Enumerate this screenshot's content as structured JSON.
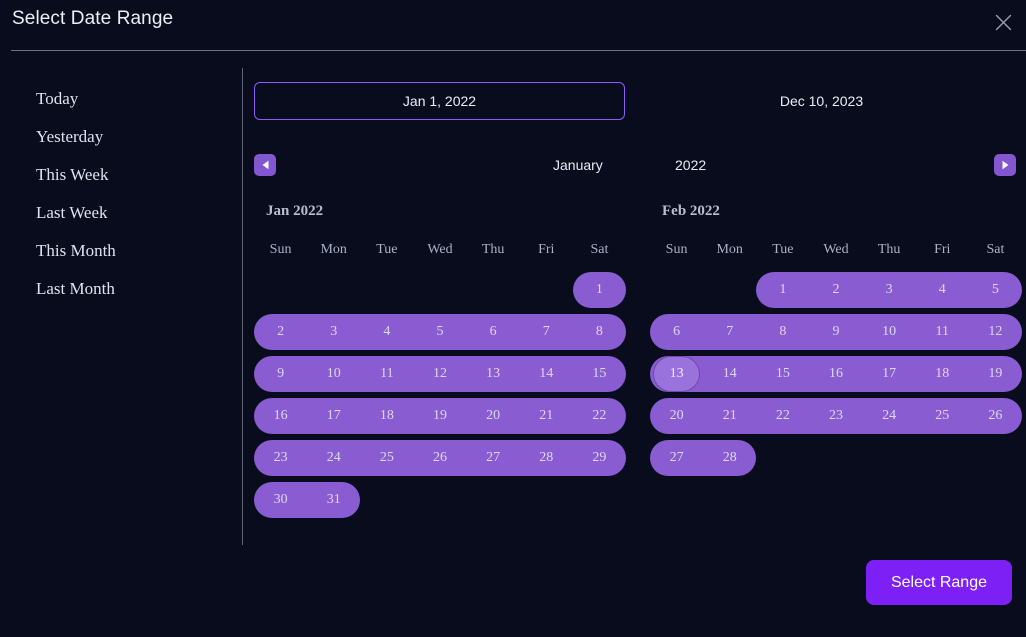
{
  "dialog": {
    "title": "Select Date Range",
    "close_icon": "close-icon"
  },
  "sidebar": {
    "presets": [
      {
        "label": "Today"
      },
      {
        "label": "Yesterday"
      },
      {
        "label": "This Week"
      },
      {
        "label": "Last Week"
      },
      {
        "label": "This Month"
      },
      {
        "label": "Last Month"
      }
    ]
  },
  "range": {
    "start_value": "Jan 1, 2022",
    "end_value": "Dec 10, 2023",
    "start_active": true
  },
  "nav": {
    "prev_icon": "triangle-left-icon",
    "next_icon": "triangle-right-icon",
    "month_value": "January",
    "year_value": "2022"
  },
  "weekdays": [
    "Sun",
    "Mon",
    "Tue",
    "Wed",
    "Thu",
    "Fri",
    "Sat"
  ],
  "months": [
    {
      "label": "Jan 2022",
      "weeks": [
        {
          "cells": [
            "",
            "",
            "",
            "",
            "",
            "",
            "1"
          ],
          "band": {
            "start": 6,
            "end": 6,
            "cap_left": true,
            "cap_right": true
          }
        },
        {
          "cells": [
            "2",
            "3",
            "4",
            "5",
            "6",
            "7",
            "8"
          ],
          "band": {
            "start": 0,
            "end": 6,
            "cap_left": true,
            "cap_right": true
          }
        },
        {
          "cells": [
            "9",
            "10",
            "11",
            "12",
            "13",
            "14",
            "15"
          ],
          "band": {
            "start": 0,
            "end": 6,
            "cap_left": true,
            "cap_right": true
          }
        },
        {
          "cells": [
            "16",
            "17",
            "18",
            "19",
            "20",
            "21",
            "22"
          ],
          "band": {
            "start": 0,
            "end": 6,
            "cap_left": true,
            "cap_right": true
          }
        },
        {
          "cells": [
            "23",
            "24",
            "25",
            "26",
            "27",
            "28",
            "29"
          ],
          "band": {
            "start": 0,
            "end": 6,
            "cap_left": true,
            "cap_right": true
          }
        },
        {
          "cells": [
            "30",
            "31",
            "",
            "",
            "",
            "",
            ""
          ],
          "band": {
            "start": 0,
            "end": 1,
            "cap_left": true,
            "cap_right": true
          }
        }
      ]
    },
    {
      "label": "Feb 2022",
      "weeks": [
        {
          "cells": [
            "",
            "",
            "1",
            "2",
            "3",
            "4",
            "5"
          ],
          "band": {
            "start": 2,
            "end": 6,
            "cap_left": true,
            "cap_right": true
          }
        },
        {
          "cells": [
            "6",
            "7",
            "8",
            "9",
            "10",
            "11",
            "12"
          ],
          "band": {
            "start": 0,
            "end": 6,
            "cap_left": true,
            "cap_right": true
          }
        },
        {
          "cells": [
            "13",
            "14",
            "15",
            "16",
            "17",
            "18",
            "19"
          ],
          "band": {
            "start": 0,
            "end": 6,
            "cap_left": true,
            "cap_right": true
          },
          "hovered": 0
        },
        {
          "cells": [
            "20",
            "21",
            "22",
            "23",
            "24",
            "25",
            "26"
          ],
          "band": {
            "start": 0,
            "end": 6,
            "cap_left": true,
            "cap_right": true
          }
        },
        {
          "cells": [
            "27",
            "28",
            "",
            "",
            "",
            "",
            ""
          ],
          "band": {
            "start": 0,
            "end": 1,
            "cap_left": true,
            "cap_right": true
          }
        }
      ]
    }
  ],
  "footer": {
    "select_range_label": "Select Range"
  },
  "colors": {
    "background": "#080c1c",
    "range_fill": "#8a5cd1",
    "hover_fill": "#9a72dc",
    "accent_border": "#8b5cf6",
    "primary_button": "#7c20f5",
    "nav_button": "#8257cf",
    "divider": "#8e94a8",
    "muted_text": "#aab2c6"
  }
}
